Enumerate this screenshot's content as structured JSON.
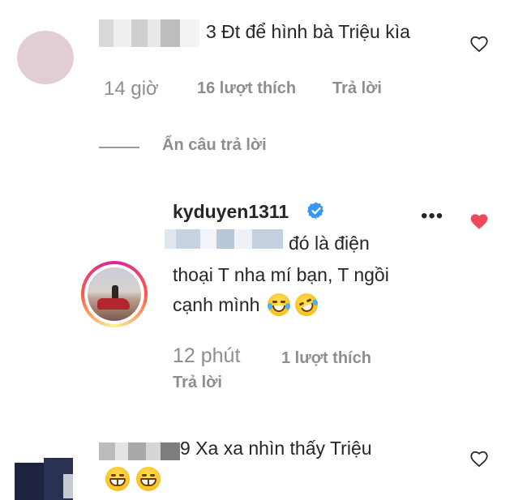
{
  "comments": [
    {
      "text": "3 Đt để hình bà Triệu kìa",
      "time": "14 giờ",
      "likes": "16 lượt thích",
      "reply": "Trả lời",
      "liked": false
    }
  ],
  "hide_replies": "Ẩn câu trả lời",
  "reply": {
    "username": "kyduyen1311",
    "verified": true,
    "more": "•••",
    "line1": "đó là điện",
    "line2": "thoại T nha mí bạn, T ngồi",
    "line3": "cạnh mình",
    "emojis": [
      "joy-emoji",
      "rofl-emoji"
    ],
    "time": "12 phút",
    "likes": "1 lượt thích",
    "reply_label": "Trả lời",
    "liked": true
  },
  "comment3": {
    "text": "9 Xa xa nhìn thấy Triệu",
    "emojis": [
      "grin-emoji",
      "grin-emoji"
    ]
  },
  "colors": {
    "text": "#262626",
    "meta": "#8e8e8e",
    "like_red": "#ed4956",
    "verified_blue": "#3897f0"
  },
  "icons": [
    "heart-outline-icon",
    "heart-filled-icon",
    "verified-badge-icon",
    "more-options-icon"
  ]
}
